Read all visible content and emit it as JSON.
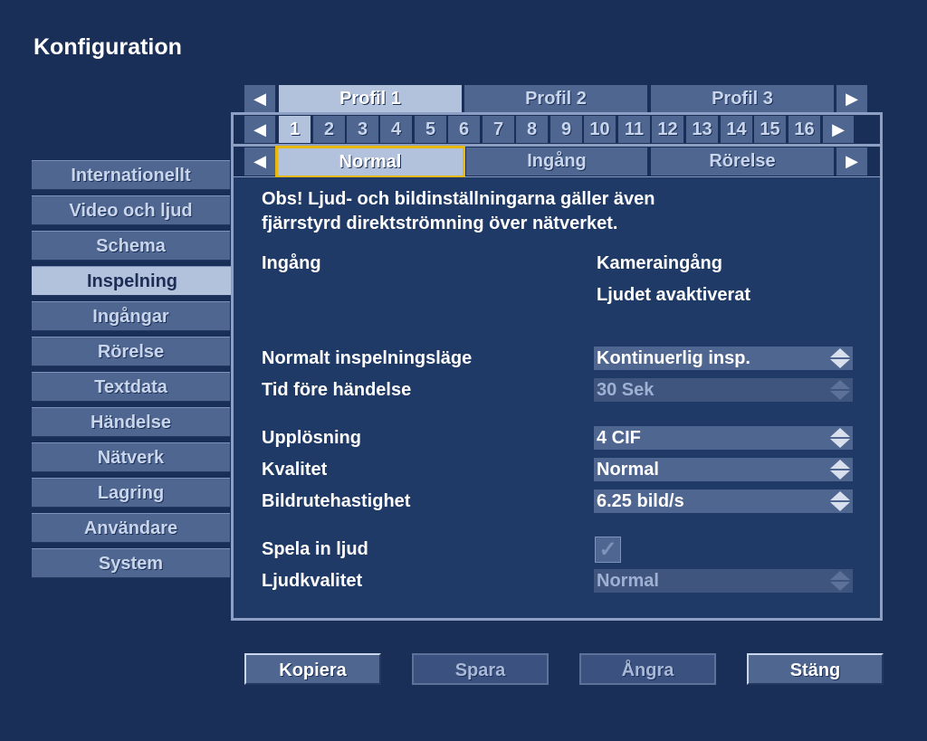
{
  "window": {
    "title": "Konfiguration"
  },
  "sidebar": {
    "items": [
      {
        "label": "Internationellt"
      },
      {
        "label": "Video och ljud"
      },
      {
        "label": "Schema"
      },
      {
        "label": "Inspelning",
        "active": true
      },
      {
        "label": "Ingångar"
      },
      {
        "label": "Rörelse"
      },
      {
        "label": "Textdata"
      },
      {
        "label": "Händelse"
      },
      {
        "label": "Nätverk"
      },
      {
        "label": "Lagring"
      },
      {
        "label": "Användare"
      },
      {
        "label": "System"
      }
    ]
  },
  "profile_tabs": {
    "prev_icon": "◀",
    "next_icon": "▶",
    "tabs": [
      {
        "label": "Profil 1",
        "active": true
      },
      {
        "label": "Profil 2"
      },
      {
        "label": "Profil 3"
      }
    ]
  },
  "channel_tabs": {
    "prev_icon": "◀",
    "next_icon": "▶",
    "numbers": [
      "1",
      "2",
      "3",
      "4",
      "5",
      "6",
      "7",
      "8",
      "9",
      "10",
      "11",
      "12",
      "13",
      "14",
      "15",
      "16"
    ],
    "active": "1"
  },
  "mode_tabs": {
    "prev_icon": "◀",
    "next_icon": "▶",
    "tabs": [
      {
        "label": "Normal",
        "active": true
      },
      {
        "label": "Ingång"
      },
      {
        "label": "Rörelse"
      }
    ]
  },
  "content": {
    "note_line1": "Obs! Ljud- och bildinställningarna gäller även",
    "note_line2": "fjärrstyrd direktströmning över nätverket.",
    "input_label": "Ingång",
    "input_value": "Kameraingång",
    "audio_status": "Ljudet avaktiverat",
    "rec_mode_label": "Normalt inspelningsläge",
    "rec_mode_value": "Kontinuerlig insp.",
    "pre_event_label": "Tid före händelse",
    "pre_event_value": "30 Sek",
    "resolution_label": "Upplösning",
    "resolution_value": "4 CIF",
    "quality_label": "Kvalitet",
    "quality_value": "Normal",
    "framerate_label": "Bildrutehastighet",
    "framerate_value": "6.25 bild/s",
    "record_audio_label": "Spela in ljud",
    "record_audio_checked": true,
    "check_icon": "✓",
    "audio_quality_label": "Ljudkvalitet",
    "audio_quality_value": "Normal"
  },
  "buttons": {
    "copy": "Kopiera",
    "save": "Spara",
    "undo": "Ångra",
    "close": "Stäng"
  }
}
